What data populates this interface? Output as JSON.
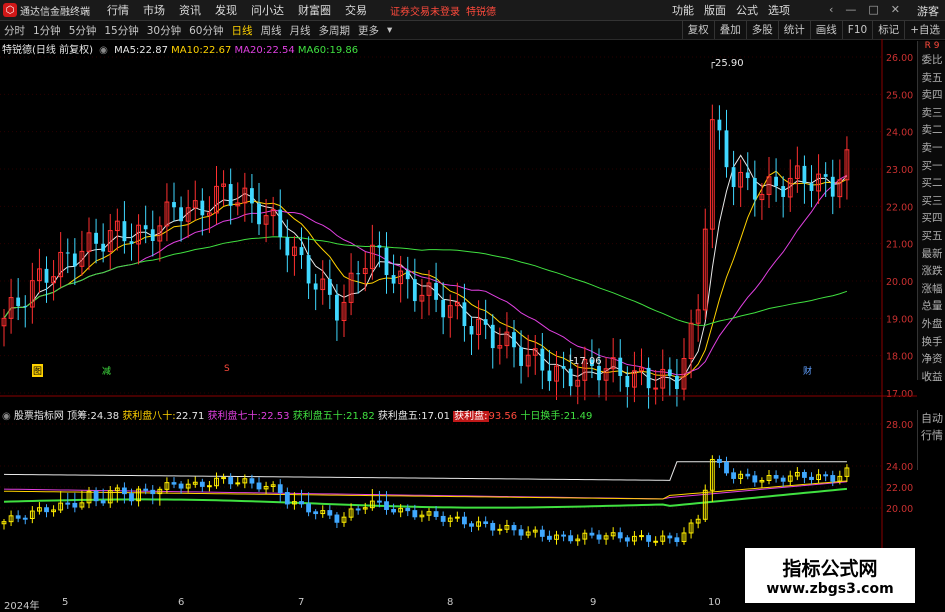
{
  "menubar": {
    "app_title": "通达信金融终端",
    "items": [
      "行情",
      "市场",
      "资讯",
      "发现",
      "问小达",
      "财富圈",
      "交易"
    ],
    "notice": "证券交易未登录",
    "stock_name": "特锐德",
    "right_items": [
      "功能",
      "版面",
      "公式",
      "选项"
    ],
    "guest": "游客"
  },
  "toolbar": {
    "periods": [
      "分时",
      "1分钟",
      "5分钟",
      "15分钟",
      "30分钟",
      "60分钟",
      "日线",
      "周线",
      "月线",
      "多周期",
      "更多"
    ],
    "active_period": "日线",
    "right_buttons": [
      "复权",
      "叠加",
      "多股",
      "统计",
      "画线",
      "F10",
      "标记",
      "+自选"
    ]
  },
  "main_chart": {
    "title": "特锐德(日线 前复权)",
    "indicators": [
      {
        "label": "MA5:",
        "value": "22.87",
        "color": "#e8e8e8"
      },
      {
        "label": "MA10:",
        "value": "22.67",
        "color": "#ffd200"
      },
      {
        "label": "MA20:",
        "value": "22.54",
        "color": "#e040e0"
      },
      {
        "label": "MA60:",
        "value": "19.86",
        "color": "#40e040"
      }
    ],
    "high_label": "25.90",
    "low_label": "17.06",
    "price_ticks": [
      "26.00",
      "25.00",
      "24.00",
      "23.00",
      "22.00",
      "21.00",
      "20.00",
      "19.00",
      "18.00",
      "17.00"
    ],
    "markers": [
      {
        "text": "图",
        "color": "#ffd200"
      },
      {
        "text": "减",
        "color": "#40e040"
      },
      {
        "text": "S",
        "color": "#ff4a3c"
      },
      {
        "text": "财",
        "color": "#60a0ff"
      }
    ]
  },
  "sub_chart": {
    "title": "股票指标网",
    "indicators": [
      {
        "label": "顶筹:",
        "value": "24.38",
        "color": "#e8e8e8"
      },
      {
        "label": "获利盘八十:",
        "value": "22.71",
        "color": "#ffd200"
      },
      {
        "label": "获利盘七十:",
        "value": "22.53",
        "color": "#e040e0"
      },
      {
        "label": "获利盘五十:",
        "value": "21.82",
        "color": "#40e040"
      },
      {
        "label": "获利盘五:",
        "value": "17.01",
        "color": "#e8e8e8"
      },
      {
        "label": "获利盘:",
        "value": "93.56",
        "color": "#ff4a3c"
      },
      {
        "label": "十日换手:",
        "value": "21.49",
        "color": "#40e040"
      }
    ],
    "price_ticks": [
      "28.00",
      "24.00",
      "22.00",
      "20.00"
    ]
  },
  "side_tabs": [
    "委比",
    "卖五",
    "卖四",
    "卖三",
    "卖二",
    "卖一",
    "买一",
    "买二",
    "买三",
    "买四",
    "买五",
    "最新",
    "涨跌",
    "涨幅",
    "总量",
    "外盘",
    "换手",
    "净资",
    "收益"
  ],
  "side_top": "R 9",
  "side_tabs2": [
    "自动",
    "行情"
  ],
  "x_axis": [
    "2024年",
    "5",
    "6",
    "7",
    "8",
    "9",
    "10"
  ],
  "watermark": {
    "title": "指标公式网",
    "url": "www.zbgs3.com"
  },
  "colors": {
    "up": "#ff3030",
    "down": "#40d8ff",
    "sub_up": "#ffee00",
    "sub_down": "#40a8ff"
  }
}
